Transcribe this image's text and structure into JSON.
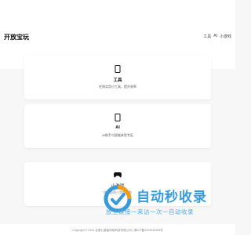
{
  "header": {
    "brand": "开放宝玩",
    "nav": [
      {
        "label": "工具"
      },
      {
        "label": "AI"
      },
      {
        "label": "小游戏"
      }
    ]
  },
  "cards": [
    {
      "icon": "phone-icon",
      "title": "工具",
      "desc": "在线实用小工具，提升效率"
    },
    {
      "icon": "phone-icon",
      "title": "AI",
      "desc": "AI助手与智能体验专区"
    },
    {
      "icon": "gamepad-icon",
      "title": "小游戏",
      "desc": "休闲益智小游戏集合"
    }
  ],
  "watermark": {
    "title": "自动秒收录",
    "slogan": "放上链接一来访一次一自动收录"
  },
  "footer": {
    "text": "Copyright © 2024 合肥九星星网络科技有限公司 | 皖ICP备2023030355号"
  },
  "colors": {
    "watermark_blue": "#3a9ad9",
    "watermark_orange": "#f39c12",
    "background": "#f7f7f7"
  }
}
